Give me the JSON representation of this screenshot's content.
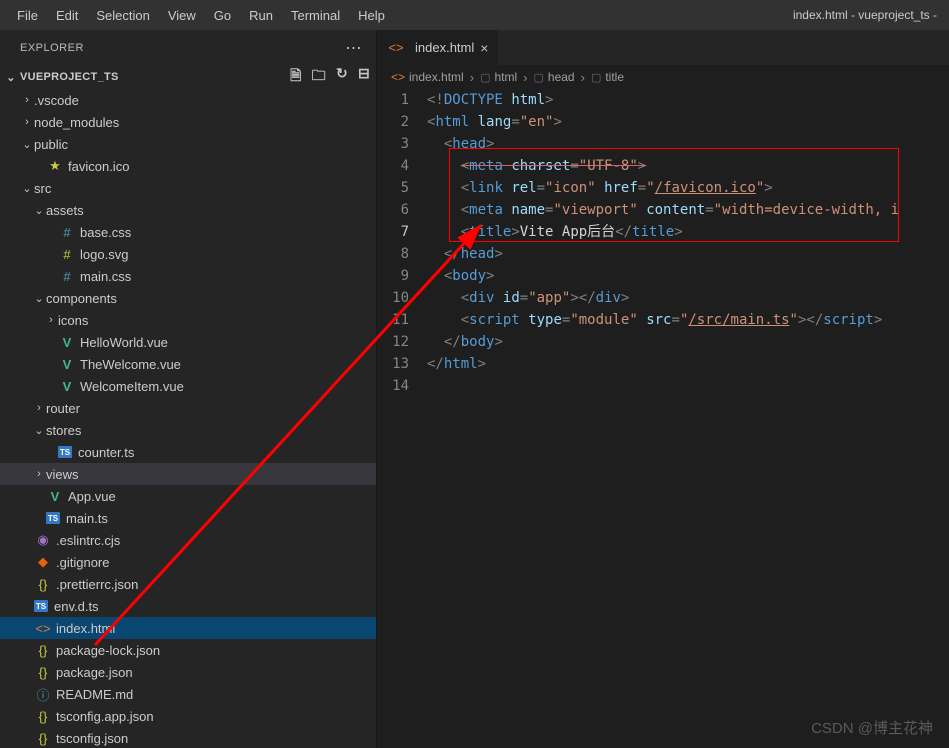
{
  "menubar": {
    "items": [
      "File",
      "Edit",
      "Selection",
      "View",
      "Go",
      "Run",
      "Terminal",
      "Help"
    ],
    "title": "index.html - vueproject_ts -"
  },
  "sidebar": {
    "header": "EXPLORER",
    "project": "VUEPROJECT_TS"
  },
  "tree": [
    {
      "d": 1,
      "t": "folder",
      "open": false,
      "i": "",
      "n": ".vscode"
    },
    {
      "d": 1,
      "t": "folder",
      "open": false,
      "i": "",
      "n": "node_modules"
    },
    {
      "d": 1,
      "t": "folder",
      "open": true,
      "i": "",
      "n": "public"
    },
    {
      "d": 2,
      "t": "file",
      "i": "star",
      "n": "favicon.ico"
    },
    {
      "d": 1,
      "t": "folder",
      "open": true,
      "i": "",
      "n": "src"
    },
    {
      "d": 2,
      "t": "folder",
      "open": true,
      "i": "",
      "n": "assets"
    },
    {
      "d": 3,
      "t": "file",
      "i": "css",
      "n": "base.css"
    },
    {
      "d": 3,
      "t": "file",
      "i": "svg",
      "n": "logo.svg"
    },
    {
      "d": 3,
      "t": "file",
      "i": "css",
      "n": "main.css"
    },
    {
      "d": 2,
      "t": "folder",
      "open": true,
      "i": "",
      "n": "components"
    },
    {
      "d": 3,
      "t": "folder",
      "open": false,
      "i": "",
      "n": "icons"
    },
    {
      "d": 3,
      "t": "file",
      "i": "vue",
      "n": "HelloWorld.vue"
    },
    {
      "d": 3,
      "t": "file",
      "i": "vue",
      "n": "TheWelcome.vue"
    },
    {
      "d": 3,
      "t": "file",
      "i": "vue",
      "n": "WelcomeItem.vue"
    },
    {
      "d": 2,
      "t": "folder",
      "open": false,
      "i": "",
      "n": "router"
    },
    {
      "d": 2,
      "t": "folder",
      "open": true,
      "i": "",
      "n": "stores"
    },
    {
      "d": 3,
      "t": "file",
      "i": "ts",
      "n": "counter.ts"
    },
    {
      "d": 2,
      "t": "folder",
      "open": false,
      "i": "",
      "n": "views",
      "sel": true
    },
    {
      "d": 2,
      "t": "file",
      "i": "vue",
      "n": "App.vue"
    },
    {
      "d": 2,
      "t": "file",
      "i": "ts",
      "n": "main.ts"
    },
    {
      "d": 1,
      "t": "file",
      "i": "gear",
      "n": ".eslintrc.cjs"
    },
    {
      "d": 1,
      "t": "file",
      "i": "git",
      "n": ".gitignore"
    },
    {
      "d": 1,
      "t": "file",
      "i": "json",
      "n": ".prettierrc.json"
    },
    {
      "d": 1,
      "t": "file",
      "i": "ts",
      "n": "env.d.ts"
    },
    {
      "d": 1,
      "t": "file",
      "i": "html",
      "n": "index.html",
      "active": true
    },
    {
      "d": 1,
      "t": "file",
      "i": "json",
      "n": "package-lock.json"
    },
    {
      "d": 1,
      "t": "file",
      "i": "json",
      "n": "package.json"
    },
    {
      "d": 1,
      "t": "file",
      "i": "info",
      "n": "README.md"
    },
    {
      "d": 1,
      "t": "file",
      "i": "json",
      "n": "tsconfig.app.json"
    },
    {
      "d": 1,
      "t": "file",
      "i": "json",
      "n": "tsconfig.json"
    }
  ],
  "tab": {
    "label": "index.html"
  },
  "breadcrumb": [
    "index.html",
    "html",
    "head",
    "title"
  ],
  "code_lines": [
    {
      "n": 1,
      "html": "<span class='c-punct'>&lt;!</span><span class='c-doctype'>DOCTYPE</span> <span class='c-attr'>html</span><span class='c-punct'>&gt;</span>"
    },
    {
      "n": 2,
      "html": "<span class='c-punct'>&lt;</span><span class='c-tag'>html</span> <span class='c-attr'>lang</span><span class='c-punct'>=</span><span class='c-str'>\"en\"</span><span class='c-punct'>&gt;</span>"
    },
    {
      "n": 3,
      "html": "  <span class='c-punct'>&lt;</span><span class='c-tag'>head</span><span class='c-punct'>&gt;</span>"
    },
    {
      "n": 4,
      "html": "    <span class='c-strike'><span class='c-punct'>&lt;</span><span class='c-tag'>meta</span> <span class='c-attr'>charset</span><span class='c-punct'>=</span><span class='c-str'>\"UTF-8\"</span><span class='c-punct'>&gt;</span></span>"
    },
    {
      "n": 5,
      "html": "    <span class='c-punct'>&lt;</span><span class='c-tag'>link</span> <span class='c-attr'>rel</span><span class='c-punct'>=</span><span class='c-str'>\"icon\"</span> <span class='c-attr'>href</span><span class='c-punct'>=</span><span class='c-str'>\"<span class='underline'>/favicon.ico</span>\"</span><span class='c-punct'>&gt;</span>"
    },
    {
      "n": 6,
      "html": "    <span class='c-punct'>&lt;</span><span class='c-tag'>meta</span> <span class='c-attr'>name</span><span class='c-punct'>=</span><span class='c-str'>\"viewport\"</span> <span class='c-attr'>content</span><span class='c-punct'>=</span><span class='c-str'>\"width=device-width, i</span>"
    },
    {
      "n": 7,
      "html": "    <span class='c-punct'>&lt;</span><span class='c-tag'>title</span><span class='c-punct'>&gt;</span><span class='c-text'>Vite App后台</span><span class='c-punct'>&lt;/</span><span class='c-tag'>title</span><span class='c-punct'>&gt;</span>",
      "current": true
    },
    {
      "n": 8,
      "html": "  <span class='c-punct'>&lt;/</span><span class='c-tag'>head</span><span class='c-punct'>&gt;</span>"
    },
    {
      "n": 9,
      "html": "  <span class='c-punct'>&lt;</span><span class='c-tag'>body</span><span class='c-punct'>&gt;</span>"
    },
    {
      "n": 10,
      "html": "    <span class='c-punct'>&lt;</span><span class='c-tag'>div</span> <span class='c-attr'>id</span><span class='c-punct'>=</span><span class='c-str'>\"app\"</span><span class='c-punct'>&gt;&lt;/</span><span class='c-tag'>div</span><span class='c-punct'>&gt;</span>"
    },
    {
      "n": 11,
      "html": "    <span class='c-punct'>&lt;</span><span class='c-tag'>script</span> <span class='c-attr'>type</span><span class='c-punct'>=</span><span class='c-str'>\"module\"</span> <span class='c-attr'>src</span><span class='c-punct'>=</span><span class='c-str'>\"<span class='underline'>/src/main.ts</span>\"</span><span class='c-punct'>&gt;&lt;/</span><span class='c-tag'>script</span><span class='c-punct'>&gt;</span>"
    },
    {
      "n": 12,
      "html": "  <span class='c-punct'>&lt;/</span><span class='c-tag'>body</span><span class='c-punct'>&gt;</span>"
    },
    {
      "n": 13,
      "html": "<span class='c-punct'>&lt;/</span><span class='c-tag'>html</span><span class='c-punct'>&gt;</span>"
    },
    {
      "n": 14,
      "html": ""
    }
  ],
  "watermark": "CSDN @博主花神",
  "icons": {
    "folder_closed": "›",
    "folder_open": "⌄",
    "star": "★",
    "vue": "V",
    "css": "#",
    "svg": "#",
    "ts": "TS",
    "json": "{}",
    "git": "◆",
    "gear": "◉",
    "info": "ⓘ",
    "html": "<>",
    "md": "ⓘ",
    "struct": "▢"
  }
}
